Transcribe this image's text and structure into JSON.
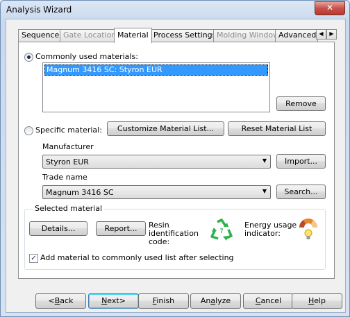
{
  "window": {
    "title": "Analysis Wizard",
    "close_glyph": "✕"
  },
  "tabs": [
    {
      "label": "Sequence",
      "state": "normal"
    },
    {
      "label": "Gate Location",
      "state": "disabled"
    },
    {
      "label": "Material",
      "state": "active"
    },
    {
      "label": "Process Settings",
      "state": "normal"
    },
    {
      "label": "Molding Window",
      "state": "disabled"
    },
    {
      "label": "Advanced",
      "state": "normal"
    }
  ],
  "tab_scroll": {
    "left_glyph": "◀",
    "right_glyph": "▶"
  },
  "commonly_used": {
    "label": "Commonly used materials:",
    "selected": true,
    "items": [
      "Magnum 3416 SC: Styron EUR"
    ],
    "remove_button": "Remove"
  },
  "specific": {
    "label": "Specific material:",
    "selected": false,
    "customize_button": "Customize Material List...",
    "reset_button": "Reset Material List",
    "manufacturer_label": "Manufacturer",
    "manufacturer_value": "Styron EUR",
    "import_button": "Import...",
    "trade_name_label": "Trade name",
    "trade_name_value": "Magnum 3416 SC",
    "search_button": "Search..."
  },
  "selected_material": {
    "group_title": "Selected material",
    "details_button": "Details...",
    "report_button": "Report...",
    "resin_label_1": "Resin",
    "resin_label_2": "identification",
    "resin_label_3": "code:",
    "resin_code": "7",
    "energy_label_1": "Energy usage",
    "energy_label_2": "indicator:",
    "add_checkbox_label": "Add material to commonly used list after selecting",
    "add_checked": true
  },
  "footer": {
    "back": {
      "pre": "<",
      "u": "B",
      "post": "ack"
    },
    "next": {
      "pre": "",
      "u": "N",
      "post": "ext>"
    },
    "finish": {
      "pre": "",
      "u": "F",
      "post": "inish"
    },
    "analyze": {
      "pre": "An",
      "u": "a",
      "post": "lyze"
    },
    "cancel": {
      "pre": "",
      "u": "C",
      "post": "ancel"
    },
    "help": {
      "pre": "",
      "u": "H",
      "post": "elp"
    }
  },
  "colors": {
    "selection": "#3399ff",
    "recycle_green": "#2db24a",
    "energy_orange": "#e58a2c"
  }
}
